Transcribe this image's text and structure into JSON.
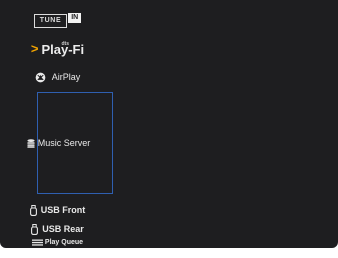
{
  "menu": {
    "tunein": {
      "tune": "TUNE",
      "in": "IN"
    },
    "playfi": {
      "dts": "dts",
      "label": "Play-Fi"
    },
    "airplay": {
      "label": "AirPlay"
    },
    "music_server": {
      "label": "Music Server"
    },
    "usb_front": {
      "label": "USB Front"
    },
    "usb_rear": {
      "label": "USB Rear"
    },
    "play_queue": {
      "label": "Play Queue"
    }
  },
  "colors": {
    "background": "#1e1e20",
    "selection_border": "#2f5fb0",
    "playfi_accent": "#f2a400",
    "text": "#e8e8e8"
  }
}
